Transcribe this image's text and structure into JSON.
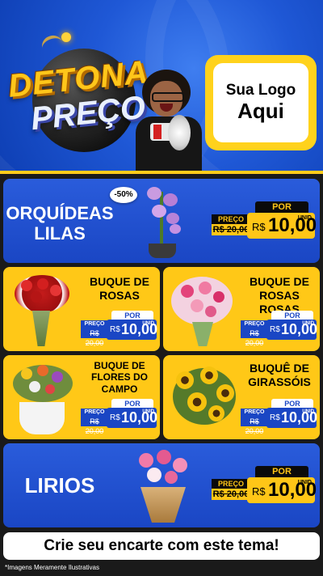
{
  "header": {
    "title_line1": "DETONA",
    "title_line2": "PREÇO",
    "logo_line1": "Sua Logo",
    "logo_line2": "Aqui"
  },
  "products": [
    {
      "name_line1": "ORQUÍDEAS",
      "name_line2": "LILAS",
      "preco_label": "PREÇO",
      "old_price": "R$ 20,00",
      "por_label": "POR",
      "currency": "R$",
      "price": "10,00",
      "unit": "UNID",
      "discount": "-50%"
    },
    {
      "name_line1": "BUQUE DE",
      "name_line2": "ROSAS",
      "preco_label": "PREÇO",
      "old_price": "R$ 20,00",
      "por_label": "POR",
      "currency": "R$",
      "price": "10,00",
      "unit": "UNID"
    },
    {
      "name_line1": "BUQUE DE",
      "name_line2": "ROSAS ROSAS",
      "preco_label": "PREÇO",
      "old_price": "R$ 20,00",
      "por_label": "POR",
      "currency": "R$",
      "price": "10,00",
      "unit": "UNID"
    },
    {
      "name_line1": "BUQUE DE",
      "name_line2": "FLORES DO",
      "name_line3": "CAMPO",
      "preco_label": "PREÇO",
      "old_price": "R$ 20,00",
      "por_label": "POR",
      "currency": "R$",
      "price": "10,00",
      "unit": "UNID"
    },
    {
      "name_line1": "BUQUÊ DE",
      "name_line2": "GIRASSÓIS",
      "preco_label": "PREÇO",
      "old_price": "R$ 20,00",
      "por_label": "POR",
      "currency": "R$",
      "price": "10,00",
      "unit": "UNID"
    },
    {
      "name_line1": "LIRIOS",
      "preco_label": "PREÇO",
      "old_price": "R$ 20,00",
      "por_label": "POR",
      "currency": "R$",
      "price": "10,00",
      "unit": "UNID"
    }
  ],
  "footer": {
    "cta": "Crie seu encarte com este tema!",
    "disclaimer": "*Imagens Meramente Ilustrativas"
  },
  "colors": {
    "blue": "#1a46c4",
    "yellow": "#ffc817",
    "black": "#0a0a0a"
  }
}
